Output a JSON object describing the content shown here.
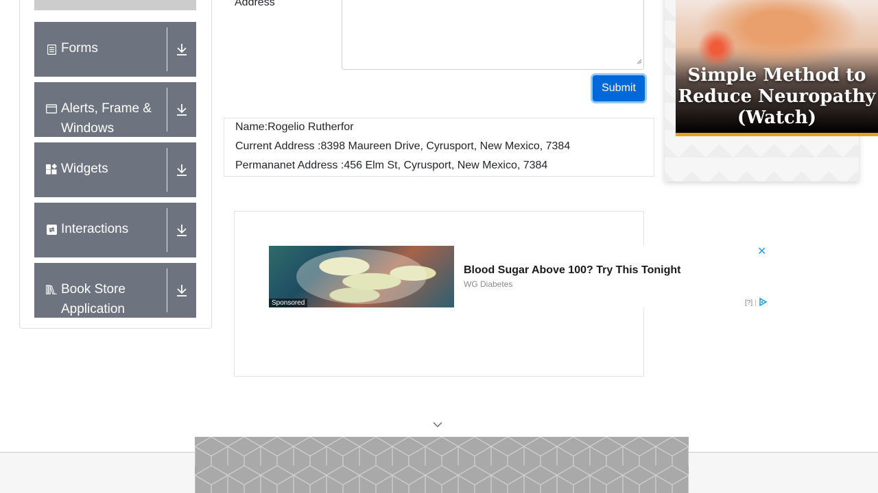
{
  "sidebar": {
    "groups": [
      {
        "label": "Forms",
        "icon": "form-icon"
      },
      {
        "label": "Alerts, Frame & Windows",
        "icon": "window-icon"
      },
      {
        "label": "Widgets",
        "icon": "widgets-icon"
      },
      {
        "label": "Interactions",
        "icon": "interactions-icon"
      },
      {
        "label": "Book Store Application",
        "icon": "books-icon"
      }
    ],
    "toggle_icon": "download-arrow-icon",
    "colors": {
      "header_bg": "#6d737f",
      "text": "#ffffff"
    }
  },
  "form": {
    "address_label": "Address",
    "submit_label": "Submit",
    "submit_color": "#0069d9"
  },
  "output": {
    "name": "Name:Rogelio Rutherfor",
    "current_address": "Current Address :8398 Maureen Drive, Cyrusport, New Mexico, 7384",
    "permanent_address": "Permananet Address :456 Elm St, Cyrusport, New Mexico, 7384"
  },
  "ad": {
    "headline": "Blood Sugar Above 100? Try This Tonight",
    "source": "WG Diabetes",
    "sponsored": "Sponsored",
    "help": "[?]",
    "close_icon": "close-icon",
    "adchoices_icon": "adchoices-icon"
  },
  "right_ad": {
    "text": "Simple Method to Reduce Neuropathy (Watch)",
    "accent_color": "#e2a21f"
  },
  "page": {
    "scroll_icon": "chevron-down-icon"
  }
}
